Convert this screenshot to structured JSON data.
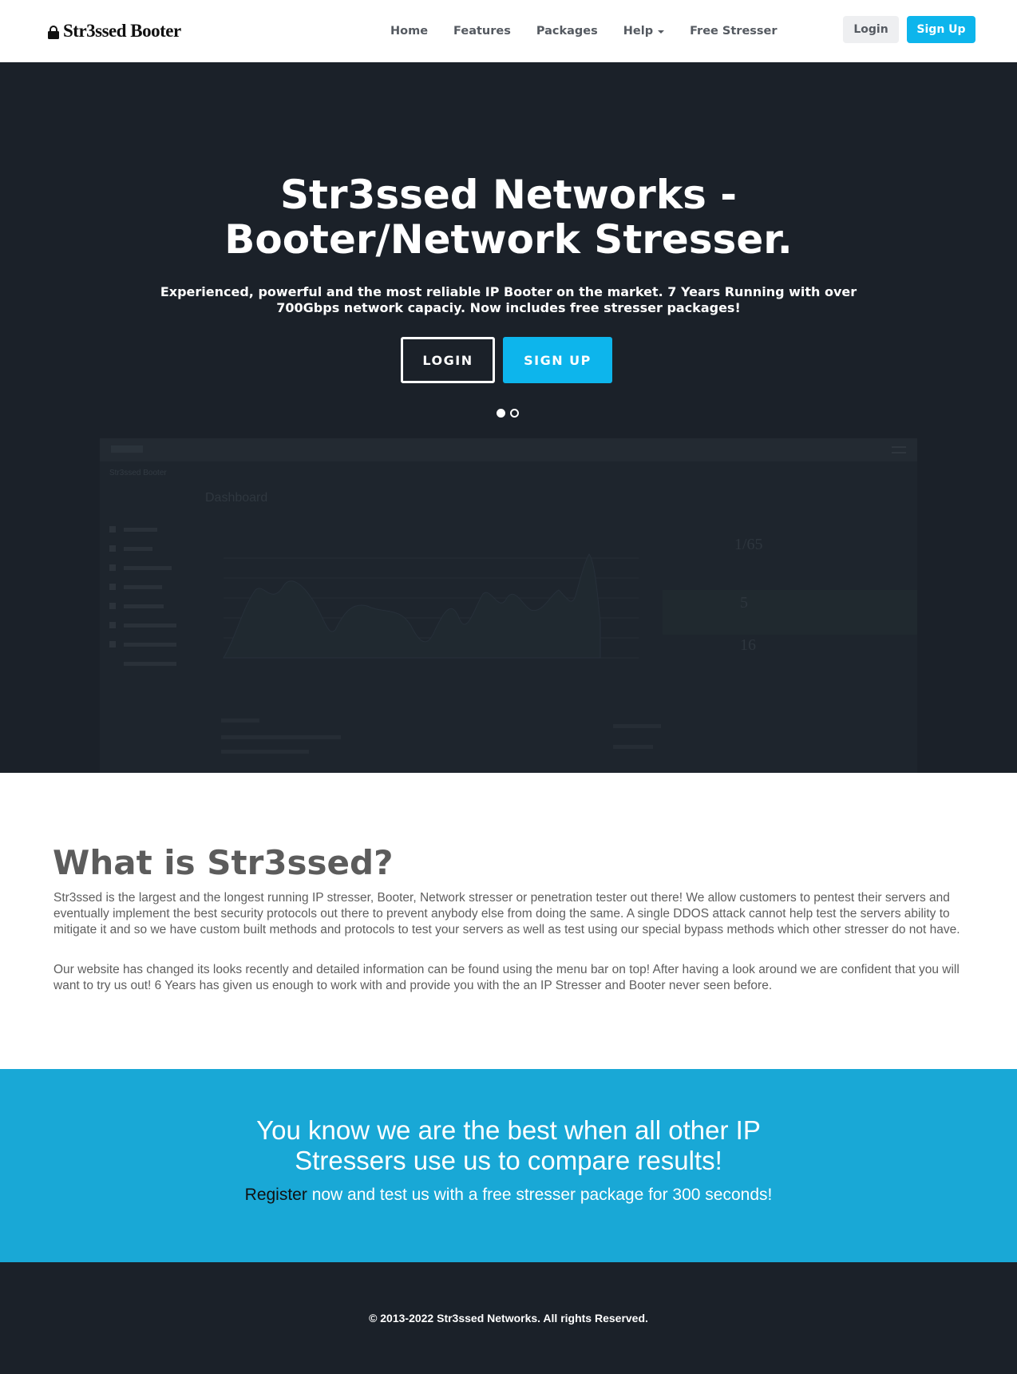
{
  "navbar": {
    "brand": "Str3ssed Booter",
    "links": [
      "Home",
      "Features",
      "Packages",
      "Help",
      "Free Stresser"
    ],
    "login": "Login",
    "signup": "Sign Up"
  },
  "hero": {
    "title_line1": "Str3ssed Networks -",
    "title_line2": "Booter/Network Stresser.",
    "subtitle": "Experienced, powerful and the most reliable IP Booter on the market. 7 Years Running with over 700Gbps network capaciy. Now includes free stresser packages!",
    "login_button": "LOGIN",
    "signup_button": "SIGN UP",
    "preview": {
      "brand": "Str3ssed Booter",
      "heading": "Dashboard",
      "stats": [
        "1/65",
        "5",
        "16"
      ]
    }
  },
  "about": {
    "title": "What is Str3ssed?",
    "paragraph1": "Str3ssed is the largest and the longest running IP stresser, Booter, Network stresser or penetration tester out there! We allow customers to pentest their servers and eventually implement the best security protocols out there to prevent anybody else from doing the same. A single DDOS attack cannot help test the servers ability to mitigate it and so we have custom built methods and protocols to test your servers as well as test using our special bypass methods which other stresser do not have.",
    "paragraph2": "Our website has changed its looks recently and detailed information can be found using the menu bar on top! After having a look around we are confident that you will want to try us out! 6 Years has given us enough to work with and provide you with the an IP Stresser and Booter never seen before."
  },
  "cta": {
    "title_line1": "You know we are the best when all other IP",
    "title_line2": "Stressers use us to compare results!",
    "register_link": "Register",
    "rest": " now and test us with a free stresser package for 300 seconds!"
  },
  "footer": {
    "copyright": "© 2013-2022 Str3ssed Networks. All rights Reserved."
  },
  "colors": {
    "accent": "#0db5ec",
    "cta_background": "#19a8d6",
    "dark_background": "#1b2129"
  }
}
